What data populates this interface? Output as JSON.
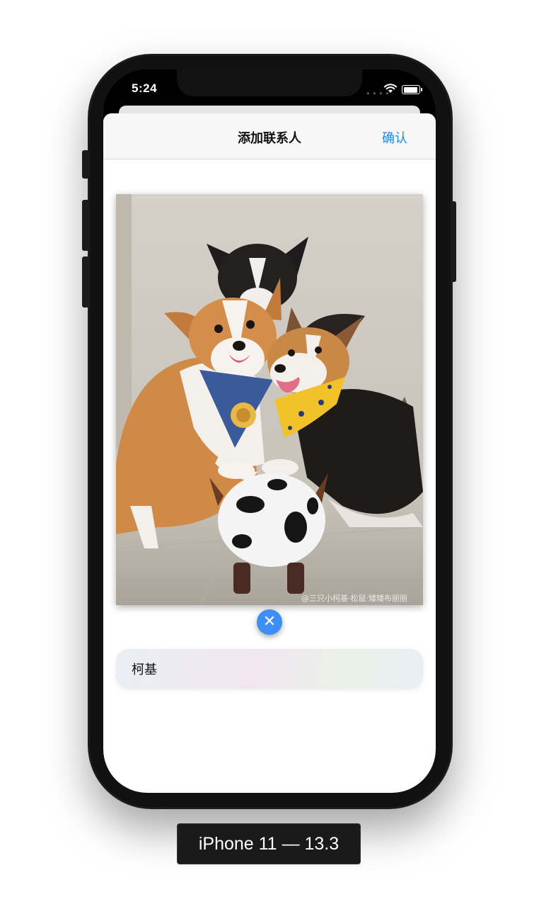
{
  "status_bar": {
    "time": "5:24",
    "cellular_icon": "cellular-dots-icon",
    "wifi_icon": "wifi-icon",
    "battery_icon": "battery-icon"
  },
  "navigation": {
    "title": "添加联系人",
    "confirm_label": "确认"
  },
  "photo": {
    "subject": "corgi-dogs-photo",
    "watermark": "@三只小柯基·松鼠·矮矮布丽丽"
  },
  "remove_button": {
    "icon": "close-icon",
    "glyph": "✕",
    "color": "#3d8ff5"
  },
  "name_field": {
    "value": "柯基"
  },
  "device_label": "iPhone 11 — 13.3",
  "colors": {
    "accent": "#1e88e5",
    "device_frame": "#1b1b1b"
  }
}
